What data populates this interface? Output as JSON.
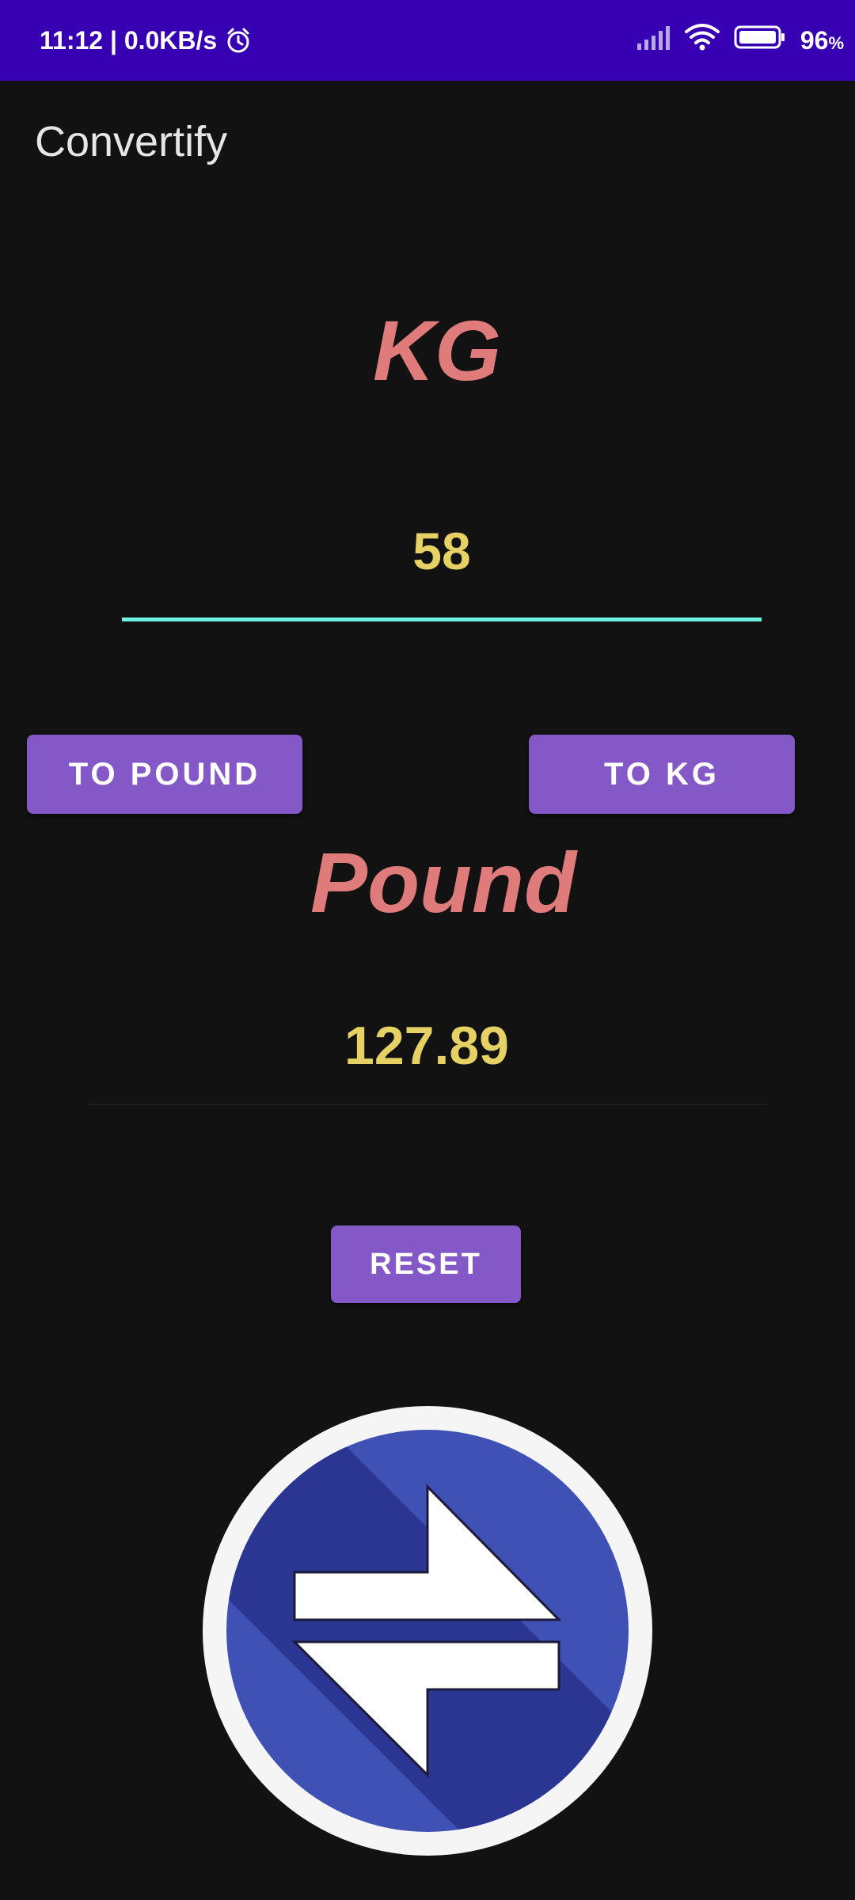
{
  "status_bar": {
    "time_speed": "11:12 | 0.0KB/s",
    "battery_percent": "96",
    "battery_unit": "%",
    "background_color": "#3700b3",
    "icons": [
      "alarm-icon",
      "signal-icon",
      "wifi-icon",
      "battery-icon"
    ]
  },
  "app": {
    "title": "Convertify"
  },
  "from_unit": {
    "label": "KG",
    "input_value": "58"
  },
  "buttons": {
    "to_pound": "TO POUND",
    "to_kg": "TO KG",
    "reset": "RESET"
  },
  "to_unit": {
    "label": "Pound",
    "output_value": "127.89"
  },
  "colors": {
    "background": "#121212",
    "button": "#8459c7",
    "unit_label": "#e07b7b",
    "value_text": "#e6d165",
    "input_underline": "#6ff0e4",
    "logo_blue": "#3f51b5"
  },
  "logo": {
    "icon": "swap-arrows-icon"
  }
}
